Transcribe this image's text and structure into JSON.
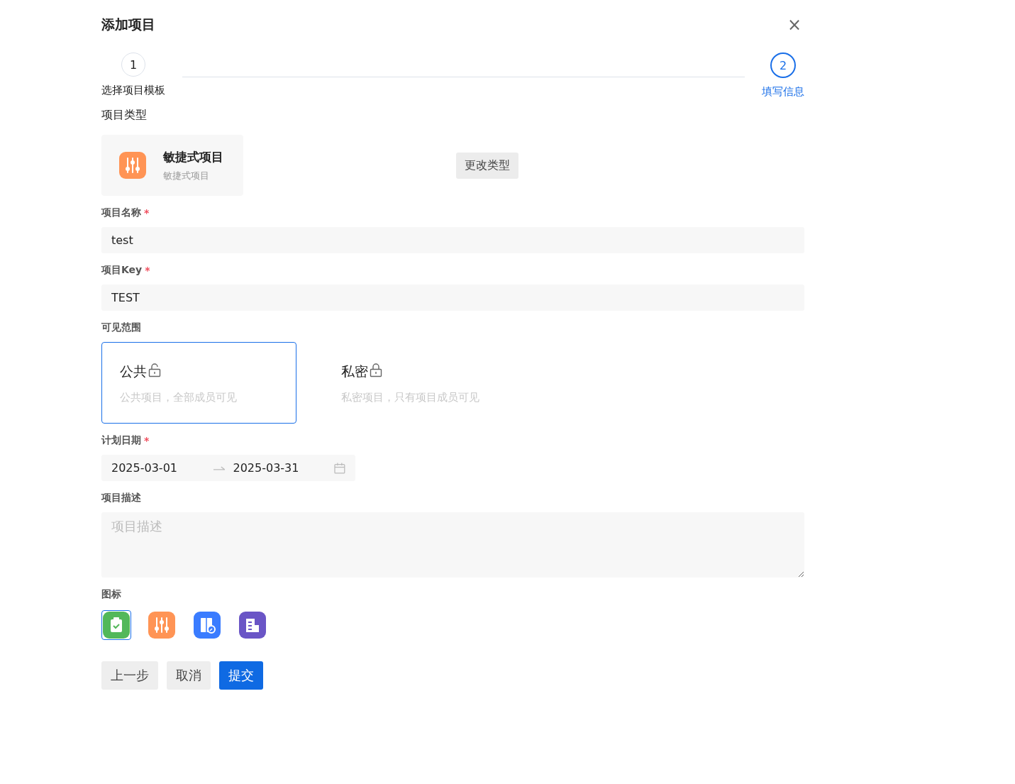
{
  "dialog": {
    "title": "添加项目",
    "close": "×"
  },
  "steps": [
    {
      "number": "1",
      "label": "选择项目模板",
      "selected": false
    },
    {
      "number": "2",
      "label": "填写信息",
      "selected": true
    }
  ],
  "project_type": {
    "label": "项目类型",
    "card": {
      "title": "敏捷式项目",
      "subtitle": "敏捷式项目"
    },
    "change_button": "更改类型"
  },
  "name_field": {
    "label": "项目名称",
    "required_mark": "*",
    "value": "test"
  },
  "key_field": {
    "label": "项目Key",
    "required_mark": "*",
    "value": "TEST"
  },
  "visibility": {
    "label": "可见范围",
    "options": [
      {
        "kind": "public",
        "title": "公共",
        "description": "公共项目，全部成员可见",
        "selected": true
      },
      {
        "kind": "private",
        "title": "私密",
        "description": "私密项目，只有项目成员可见",
        "selected": false
      }
    ]
  },
  "plan_date": {
    "label": "计划日期",
    "required_mark": "*",
    "start": "2025-03-01",
    "end": "2025-03-31"
  },
  "description": {
    "label": "项目描述",
    "placeholder": "项目描述"
  },
  "icon_picker": {
    "label": "图标",
    "items": [
      {
        "kind": "clipboard",
        "color": "#52b85a",
        "selected": true
      },
      {
        "kind": "sliders",
        "color": "#ff9455",
        "selected": false
      },
      {
        "kind": "device",
        "color": "#3a7cff",
        "selected": false
      },
      {
        "kind": "building",
        "color": "#6a55c6",
        "selected": false
      }
    ]
  },
  "buttons": [
    {
      "label": "上一步",
      "kind": "secondary"
    },
    {
      "label": "取消",
      "kind": "secondary"
    },
    {
      "label": "提交",
      "kind": "primary"
    }
  ]
}
